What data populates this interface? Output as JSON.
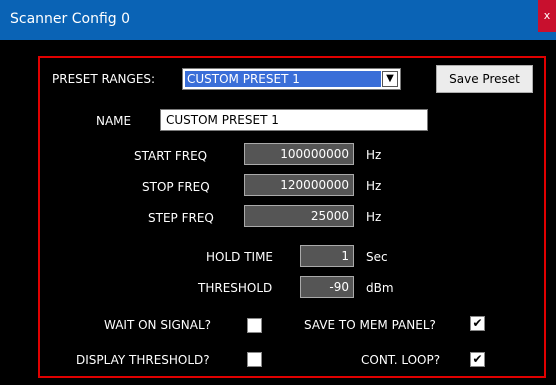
{
  "window": {
    "title": "Scanner Config 0",
    "close_label": "x"
  },
  "preset": {
    "label": "PRESET RANGES:",
    "selected": "CUSTOM PRESET 1",
    "save_label": "Save Preset"
  },
  "name": {
    "label": "NAME",
    "value": "CUSTOM PRESET 1"
  },
  "start_freq": {
    "label": "START FREQ",
    "value": "100000000",
    "unit": "Hz"
  },
  "stop_freq": {
    "label": "STOP FREQ",
    "value": "120000000",
    "unit": "Hz"
  },
  "step_freq": {
    "label": "STEP FREQ",
    "value": "25000",
    "unit": "Hz"
  },
  "hold_time": {
    "label": "HOLD TIME",
    "value": "1",
    "unit": "Sec"
  },
  "threshold": {
    "label": "THRESHOLD",
    "value": "-90",
    "unit": "dBm"
  },
  "options": {
    "wait_on_signal": {
      "label": "WAIT ON SIGNAL?",
      "checked": false
    },
    "save_to_mem": {
      "label": "SAVE TO MEM PANEL?",
      "checked": true
    },
    "display_threshold": {
      "label": "DISPLAY THRESHOLD?",
      "checked": false
    },
    "cont_loop": {
      "label": "CONT. LOOP?",
      "checked": true
    }
  },
  "colors": {
    "titlebar": "#0a63b5",
    "frame_border": "#e00000",
    "selection": "#3a6ed8",
    "close": "#c8102e"
  }
}
